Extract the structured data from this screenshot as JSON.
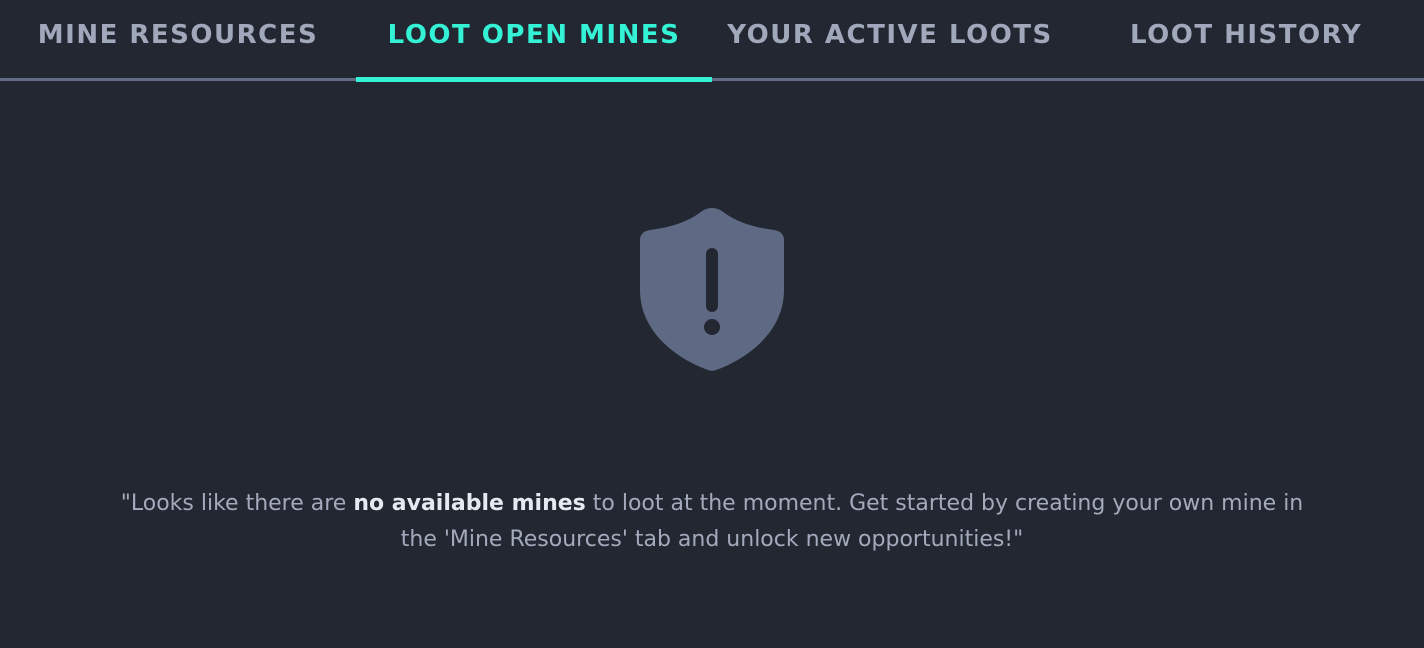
{
  "tabs": [
    {
      "label": "MINE RESOURCES",
      "active": false
    },
    {
      "label": "LOOT OPEN MINES",
      "active": true
    },
    {
      "label": "YOUR ACTIVE LOOTS",
      "active": false
    },
    {
      "label": "LOOT HISTORY",
      "active": false
    }
  ],
  "empty_state": {
    "icon": "shield-alert-icon",
    "message_before": "\"Looks like there are ",
    "message_bold": "no available mines",
    "message_after": " to loot at the moment. Get started by creating your own mine in the 'Mine Resources' tab and unlock new opportunities!\""
  },
  "colors": {
    "background": "#232731",
    "accent": "#34f2d6",
    "tab_text": "#a1a8bb",
    "divider": "#616b83",
    "icon": "#5e6a84",
    "message_text": "#a3aabb",
    "message_emphasis": "#e6e9f0"
  }
}
